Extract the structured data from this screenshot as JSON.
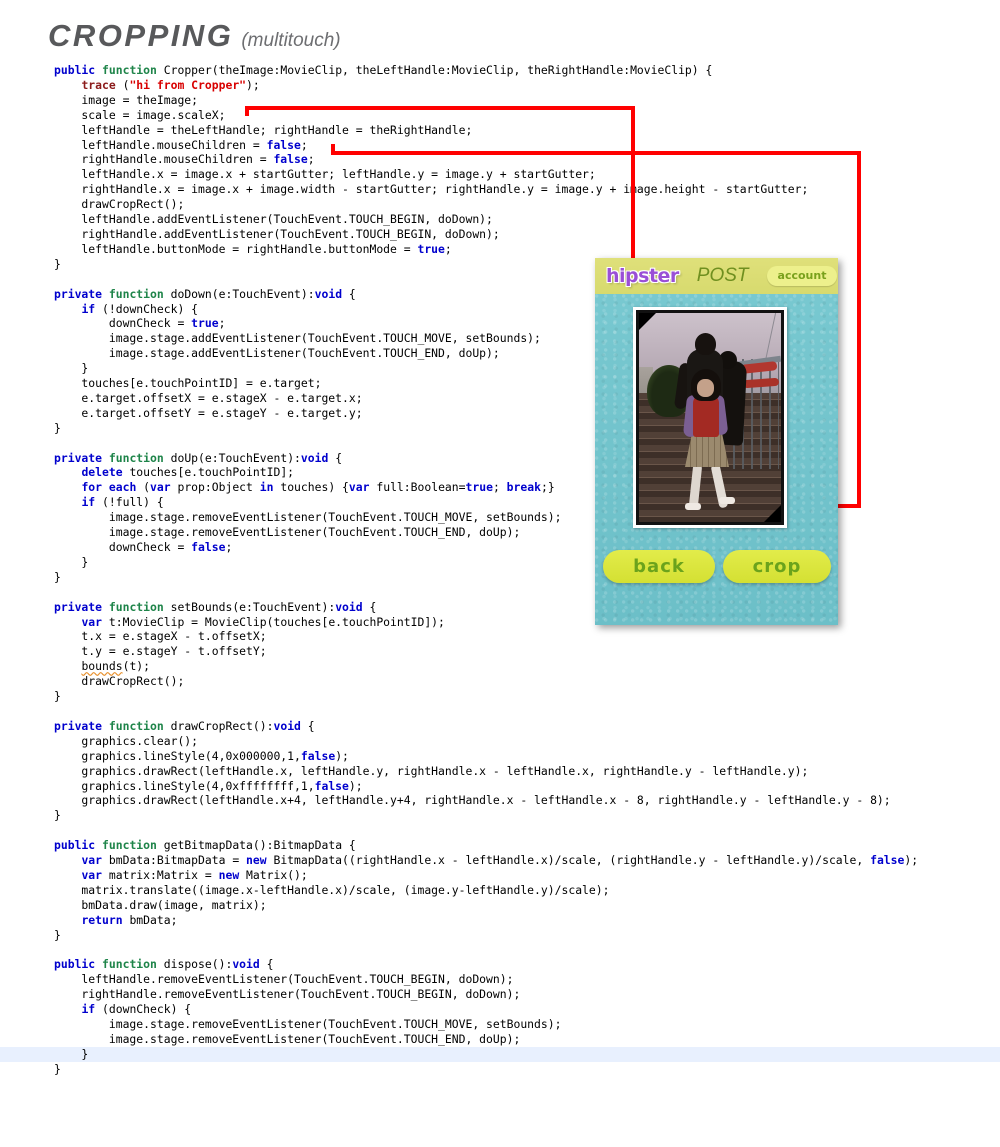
{
  "title": {
    "main": "CROPPING",
    "sub": "(multitouch)"
  },
  "colors": {
    "keyword": "#0000cd",
    "function": "#1e8449",
    "trace": "#8b1a1a",
    "string": "#d80000",
    "annotation_line": "#ff0000",
    "selection_highlight": "#e8f0fe",
    "phone_background": "#6ec6cf",
    "header_bar": "#dfe07a",
    "logo_purple": "#9a4fd6",
    "button_green": "#d4e033",
    "button_text": "#6ba31c"
  },
  "code": {
    "language": "ActionScript 3",
    "lines": [
      "public function Cropper(theImage:MovieClip, theLeftHandle:MovieClip, theRightHandle:MovieClip) {",
      "    trace (\"hi from Cropper\");",
      "    image = theImage;",
      "    scale = image.scaleX;",
      "    leftHandle = theLeftHandle; rightHandle = theRightHandle;",
      "    leftHandle.mouseChildren = false;",
      "    rightHandle.mouseChildren = false;",
      "    leftHandle.x = image.x + startGutter; leftHandle.y = image.y + startGutter;",
      "    rightHandle.x = image.x + image.width - startGutter; rightHandle.y = image.y + image.height - startGutter;",
      "    drawCropRect();",
      "    leftHandle.addEventListener(TouchEvent.TOUCH_BEGIN, doDown);",
      "    rightHandle.addEventListener(TouchEvent.TOUCH_BEGIN, doDown);",
      "    leftHandle.buttonMode = rightHandle.buttonMode = true;",
      "}",
      "",
      "private function doDown(e:TouchEvent):void {",
      "    if (!downCheck) {",
      "        downCheck = true;",
      "        image.stage.addEventListener(TouchEvent.TOUCH_MOVE, setBounds);",
      "        image.stage.addEventListener(TouchEvent.TOUCH_END, doUp);",
      "    }",
      "    touches[e.touchPointID] = e.target;",
      "    e.target.offsetX = e.stageX - e.target.x;",
      "    e.target.offsetY = e.stageY - e.target.y;",
      "}",
      "",
      "private function doUp(e:TouchEvent):void {",
      "    delete touches[e.touchPointID];",
      "    for each (var prop:Object in touches) {var full:Boolean=true; break;}",
      "    if (!full) {",
      "        image.stage.removeEventListener(TouchEvent.TOUCH_MOVE, setBounds);",
      "        image.stage.removeEventListener(TouchEvent.TOUCH_END, doUp);",
      "        downCheck = false;",
      "    }",
      "}",
      "",
      "private function setBounds(e:TouchEvent):void {",
      "    var t:MovieClip = MovieClip(touches[e.touchPointID]);",
      "    t.x = e.stageX - t.offsetX;",
      "    t.y = e.stageY - t.offsetY;",
      "    bounds(t);",
      "    drawCropRect();",
      "}",
      "",
      "private function drawCropRect():void {",
      "    graphics.clear();",
      "    graphics.lineStyle(4,0x000000,1,false);",
      "    graphics.drawRect(leftHandle.x, leftHandle.y, rightHandle.x - leftHandle.x, rightHandle.y - leftHandle.y);",
      "    graphics.lineStyle(4,0xffffffff,1,false);",
      "    graphics.drawRect(leftHandle.x+4, leftHandle.y+4, rightHandle.x - leftHandle.x - 8, rightHandle.y - leftHandle.y - 8);",
      "}",
      "",
      "public function getBitmapData():BitmapData {",
      "    var bmData:BitmapData = new BitmapData((rightHandle.x - leftHandle.x)/scale, (rightHandle.y - leftHandle.y)/scale, false);",
      "    var matrix:Matrix = new Matrix();",
      "    matrix.translate((image.x-leftHandle.x)/scale, (image.y-leftHandle.y)/scale);",
      "    bmData.draw(image, matrix);",
      "    return bmData;",
      "}",
      "",
      "public function dispose():void {",
      "    leftHandle.removeEventListener(TouchEvent.TOUCH_BEGIN, doDown);",
      "    rightHandle.removeEventListener(TouchEvent.TOUCH_BEGIN, doDown);",
      "    if (downCheck) {",
      "        image.stage.removeEventListener(TouchEvent.TOUCH_MOVE, setBounds);",
      "        image.stage.removeEventListener(TouchEvent.TOUCH_END, doUp);",
      "    }",
      "}"
    ],
    "highlighted_line_index": 66
  },
  "annotations": {
    "leader_lines": [
      {
        "name": "left-handle-connector",
        "from_code_line": "scale = image.scaleX;",
        "to_target": "top-left-crop-handle"
      },
      {
        "name": "right-handle-connector",
        "from_code_line": "leftHandle.mouseChildren = false;",
        "to_target": "bottom-right-crop-handle"
      }
    ]
  },
  "app": {
    "logo": "hipster",
    "tab": "POST",
    "account_button": "account",
    "buttons": {
      "back": "back",
      "crop": "crop"
    },
    "photo": {
      "description": "vintage photo of three people standing on concrete steps by a railing"
    },
    "handles": {
      "top_left": "crop-handle-top-left",
      "bottom_right": "crop-handle-bottom-right"
    }
  }
}
